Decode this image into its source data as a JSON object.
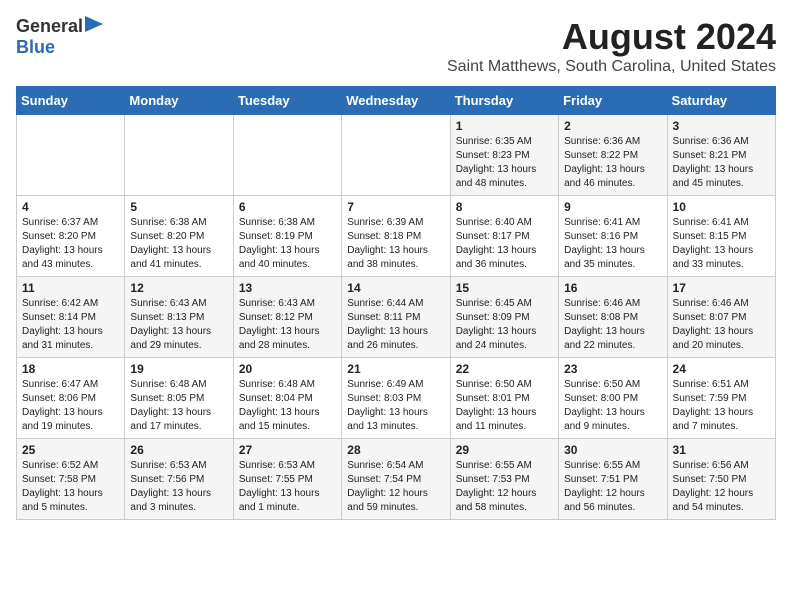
{
  "header": {
    "logo_general": "General",
    "logo_blue": "Blue",
    "month_title": "August 2024",
    "location": "Saint Matthews, South Carolina, United States"
  },
  "days_of_week": [
    "Sunday",
    "Monday",
    "Tuesday",
    "Wednesday",
    "Thursday",
    "Friday",
    "Saturday"
  ],
  "weeks": [
    [
      {
        "day": "",
        "info": ""
      },
      {
        "day": "",
        "info": ""
      },
      {
        "day": "",
        "info": ""
      },
      {
        "day": "",
        "info": ""
      },
      {
        "day": "1",
        "info": "Sunrise: 6:35 AM\nSunset: 8:23 PM\nDaylight: 13 hours\nand 48 minutes."
      },
      {
        "day": "2",
        "info": "Sunrise: 6:36 AM\nSunset: 8:22 PM\nDaylight: 13 hours\nand 46 minutes."
      },
      {
        "day": "3",
        "info": "Sunrise: 6:36 AM\nSunset: 8:21 PM\nDaylight: 13 hours\nand 45 minutes."
      }
    ],
    [
      {
        "day": "4",
        "info": "Sunrise: 6:37 AM\nSunset: 8:20 PM\nDaylight: 13 hours\nand 43 minutes."
      },
      {
        "day": "5",
        "info": "Sunrise: 6:38 AM\nSunset: 8:20 PM\nDaylight: 13 hours\nand 41 minutes."
      },
      {
        "day": "6",
        "info": "Sunrise: 6:38 AM\nSunset: 8:19 PM\nDaylight: 13 hours\nand 40 minutes."
      },
      {
        "day": "7",
        "info": "Sunrise: 6:39 AM\nSunset: 8:18 PM\nDaylight: 13 hours\nand 38 minutes."
      },
      {
        "day": "8",
        "info": "Sunrise: 6:40 AM\nSunset: 8:17 PM\nDaylight: 13 hours\nand 36 minutes."
      },
      {
        "day": "9",
        "info": "Sunrise: 6:41 AM\nSunset: 8:16 PM\nDaylight: 13 hours\nand 35 minutes."
      },
      {
        "day": "10",
        "info": "Sunrise: 6:41 AM\nSunset: 8:15 PM\nDaylight: 13 hours\nand 33 minutes."
      }
    ],
    [
      {
        "day": "11",
        "info": "Sunrise: 6:42 AM\nSunset: 8:14 PM\nDaylight: 13 hours\nand 31 minutes."
      },
      {
        "day": "12",
        "info": "Sunrise: 6:43 AM\nSunset: 8:13 PM\nDaylight: 13 hours\nand 29 minutes."
      },
      {
        "day": "13",
        "info": "Sunrise: 6:43 AM\nSunset: 8:12 PM\nDaylight: 13 hours\nand 28 minutes."
      },
      {
        "day": "14",
        "info": "Sunrise: 6:44 AM\nSunset: 8:11 PM\nDaylight: 13 hours\nand 26 minutes."
      },
      {
        "day": "15",
        "info": "Sunrise: 6:45 AM\nSunset: 8:09 PM\nDaylight: 13 hours\nand 24 minutes."
      },
      {
        "day": "16",
        "info": "Sunrise: 6:46 AM\nSunset: 8:08 PM\nDaylight: 13 hours\nand 22 minutes."
      },
      {
        "day": "17",
        "info": "Sunrise: 6:46 AM\nSunset: 8:07 PM\nDaylight: 13 hours\nand 20 minutes."
      }
    ],
    [
      {
        "day": "18",
        "info": "Sunrise: 6:47 AM\nSunset: 8:06 PM\nDaylight: 13 hours\nand 19 minutes."
      },
      {
        "day": "19",
        "info": "Sunrise: 6:48 AM\nSunset: 8:05 PM\nDaylight: 13 hours\nand 17 minutes."
      },
      {
        "day": "20",
        "info": "Sunrise: 6:48 AM\nSunset: 8:04 PM\nDaylight: 13 hours\nand 15 minutes."
      },
      {
        "day": "21",
        "info": "Sunrise: 6:49 AM\nSunset: 8:03 PM\nDaylight: 13 hours\nand 13 minutes."
      },
      {
        "day": "22",
        "info": "Sunrise: 6:50 AM\nSunset: 8:01 PM\nDaylight: 13 hours\nand 11 minutes."
      },
      {
        "day": "23",
        "info": "Sunrise: 6:50 AM\nSunset: 8:00 PM\nDaylight: 13 hours\nand 9 minutes."
      },
      {
        "day": "24",
        "info": "Sunrise: 6:51 AM\nSunset: 7:59 PM\nDaylight: 13 hours\nand 7 minutes."
      }
    ],
    [
      {
        "day": "25",
        "info": "Sunrise: 6:52 AM\nSunset: 7:58 PM\nDaylight: 13 hours\nand 5 minutes."
      },
      {
        "day": "26",
        "info": "Sunrise: 6:53 AM\nSunset: 7:56 PM\nDaylight: 13 hours\nand 3 minutes."
      },
      {
        "day": "27",
        "info": "Sunrise: 6:53 AM\nSunset: 7:55 PM\nDaylight: 13 hours\nand 1 minute."
      },
      {
        "day": "28",
        "info": "Sunrise: 6:54 AM\nSunset: 7:54 PM\nDaylight: 12 hours\nand 59 minutes."
      },
      {
        "day": "29",
        "info": "Sunrise: 6:55 AM\nSunset: 7:53 PM\nDaylight: 12 hours\nand 58 minutes."
      },
      {
        "day": "30",
        "info": "Sunrise: 6:55 AM\nSunset: 7:51 PM\nDaylight: 12 hours\nand 56 minutes."
      },
      {
        "day": "31",
        "info": "Sunrise: 6:56 AM\nSunset: 7:50 PM\nDaylight: 12 hours\nand 54 minutes."
      }
    ]
  ]
}
